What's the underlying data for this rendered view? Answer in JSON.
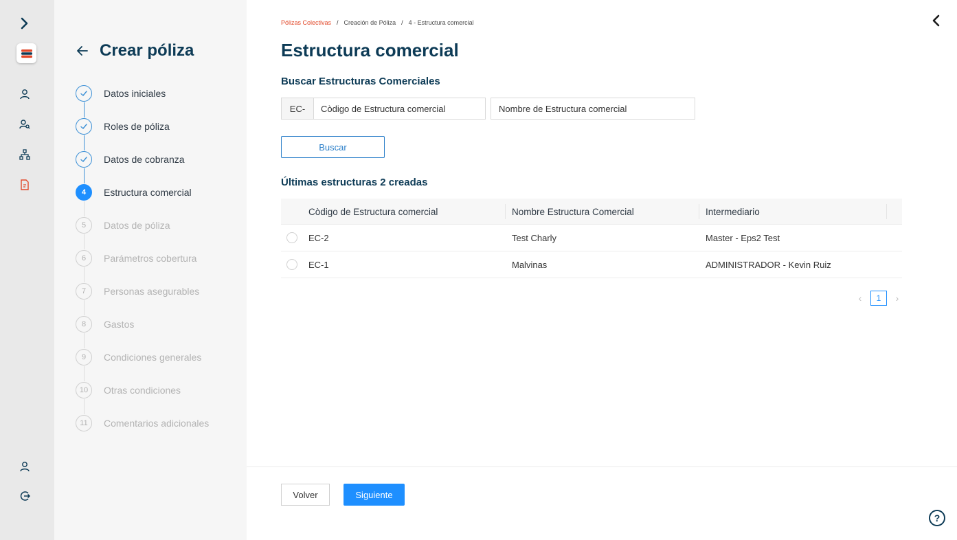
{
  "rail": {
    "expand_icon": "chevron-right-icon",
    "logo": "S",
    "items": [
      "user-icon",
      "users-search-icon",
      "org-chart-icon",
      "document-icon"
    ],
    "bottom": [
      "profile-icon",
      "logout-icon"
    ]
  },
  "wizard": {
    "title": "Crear póliza",
    "steps": [
      {
        "num": "1",
        "label": "Datos iniciales",
        "state": "done"
      },
      {
        "num": "2",
        "label": "Roles de póliza",
        "state": "done"
      },
      {
        "num": "3",
        "label": "Datos de cobranza",
        "state": "done"
      },
      {
        "num": "4",
        "label": "Estructura comercial",
        "state": "active"
      },
      {
        "num": "5",
        "label": "Datos de póliza",
        "state": "pending"
      },
      {
        "num": "6",
        "label": "Parámetros cobertura",
        "state": "pending"
      },
      {
        "num": "7",
        "label": "Personas asegurables",
        "state": "pending"
      },
      {
        "num": "8",
        "label": "Gastos",
        "state": "pending"
      },
      {
        "num": "9",
        "label": "Condiciones generales",
        "state": "pending"
      },
      {
        "num": "10",
        "label": "Otras condiciones",
        "state": "pending"
      },
      {
        "num": "11",
        "label": "Comentarios adicionales",
        "state": "pending"
      }
    ]
  },
  "breadcrumb": [
    "Pólizas Colectivas",
    "Creación de Póliza",
    "4 - Estructura comercial"
  ],
  "page_title": "Estructura comercial",
  "search": {
    "heading": "Buscar Estructuras Comerciales",
    "prefix": "EC-",
    "code_placeholder": "Còdigo de Estructura comercial",
    "name_placeholder": "Nombre de Estructura comercial",
    "button": "Buscar"
  },
  "results": {
    "heading": "Últimas estructuras 2 creadas",
    "columns": [
      "Còdigo de Estructura comercial",
      "Nombre Estructura Comercial",
      "Intermediario"
    ],
    "rows": [
      [
        "EC-2",
        "Test Charly",
        "Master - Eps2 Test"
      ],
      [
        "EC-1",
        "Malvinas",
        "ADMINISTRADOR - Kevin Ruiz"
      ]
    ],
    "pager": {
      "prev": "‹",
      "page": "1",
      "next": "›"
    }
  },
  "footer": {
    "back": "Volver",
    "next": "Siguiente"
  },
  "help": "?",
  "colors": {
    "accent": "#1e8fff",
    "heading": "#0d3b56",
    "brand": "#e2492a"
  }
}
